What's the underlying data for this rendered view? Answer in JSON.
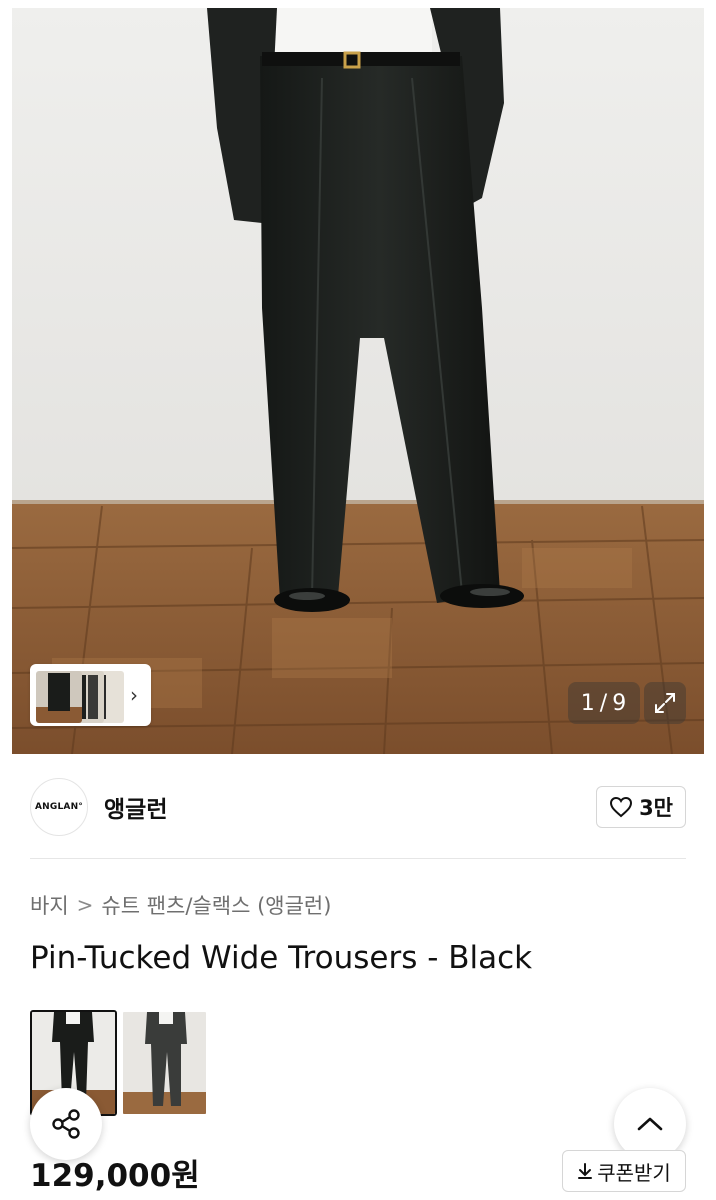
{
  "gallery": {
    "counter_current": "1",
    "counter_sep": "/",
    "counter_total": "9",
    "more_chevron": "›"
  },
  "brand": {
    "logo_text": "ANGLAN°",
    "name": "앵글런",
    "likes": "3만"
  },
  "breadcrumb": {
    "items": [
      "바지",
      "슈트 팬츠/슬랙스 (앵글런)"
    ],
    "separator": ">"
  },
  "product": {
    "title": "Pin-Tucked Wide Trousers - Black",
    "price": "129,000원",
    "coupon_label": "쿠폰받기"
  },
  "icons": {
    "expand": "expand-icon",
    "heart": "heart-icon",
    "share": "share-icon",
    "scroll_top": "chevron-up-icon",
    "download": "download-icon"
  },
  "colors": {
    "trousers": "#1c1f1d",
    "wall": "#ececea",
    "floor": "#8a5a34"
  }
}
